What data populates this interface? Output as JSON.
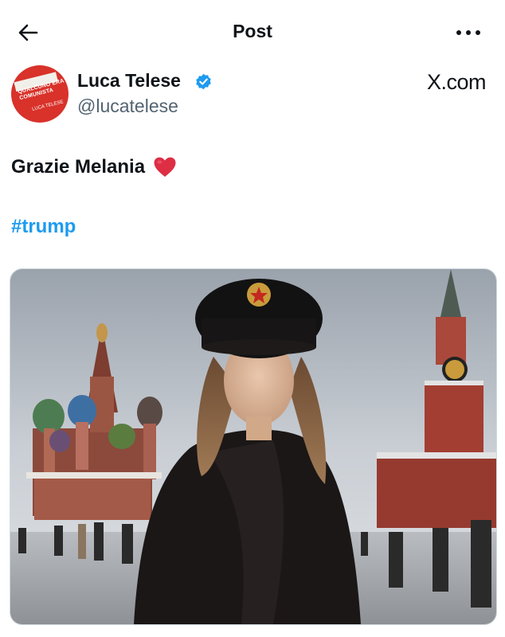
{
  "header": {
    "title": "Post",
    "back_icon": "arrow-left-icon",
    "more_icon": "more-horizontal-icon"
  },
  "author": {
    "name": "Luca Telese",
    "handle": "@lucatelese",
    "verified": true,
    "avatar": {
      "book_title": "QUALCUNO ERA COMUNISTA",
      "book_author": "LUCA TELESE",
      "color": "#d8322a"
    }
  },
  "watermark": "X.com",
  "post": {
    "text": "Grazie Melania",
    "emoji": "heart-emoji",
    "hashtag": "#trump"
  },
  "media": {
    "type": "image",
    "scene": "photo"
  },
  "colors": {
    "accent": "#1d9bf0",
    "text": "#0f1419",
    "secondary": "#536471"
  }
}
